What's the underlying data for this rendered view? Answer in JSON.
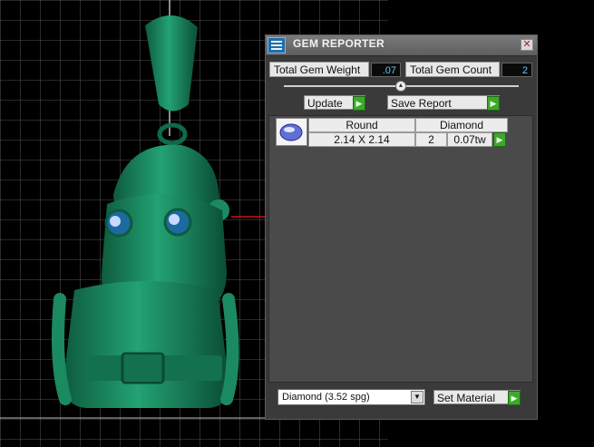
{
  "window": {
    "title": "GEM REPORTER",
    "close_glyph": "✕"
  },
  "summary": {
    "total_weight_label": "Total Gem Weight",
    "total_weight_value": ".07",
    "total_count_label": "Total Gem Count",
    "total_count_value": "2"
  },
  "buttons": {
    "update_label": "Update",
    "save_report_label": "Save Report",
    "set_material_label": "Set Material"
  },
  "table": {
    "header": {
      "shape": "Round",
      "material": "Diamond"
    },
    "rows": [
      {
        "size": "2.14 X 2.14",
        "count": "2",
        "weight": "0.07tw"
      }
    ]
  },
  "material_select": {
    "selected": "Diamond     (3.52 spg)"
  },
  "icons": {
    "app": "gem-reporter-app-icon",
    "go": "green-arrow-icon",
    "gem": "round-gem-icon"
  },
  "colors": {
    "panel": "#3a3a3a",
    "value_text": "#5fc8ff",
    "go_green": "#3ea82a",
    "model_green": "#1f8f63"
  }
}
